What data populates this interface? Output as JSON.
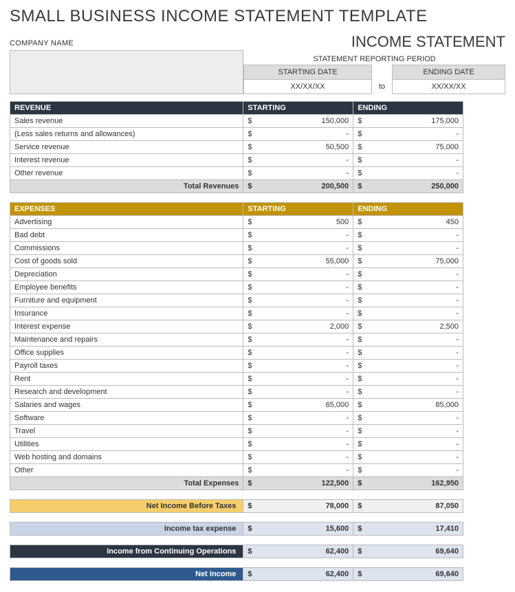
{
  "title": "SMALL BUSINESS INCOME STATEMENT TEMPLATE",
  "subtitle": "INCOME STATEMENT",
  "company": {
    "label": "COMPANY NAME"
  },
  "period": {
    "title": "STATEMENT REPORTING PERIOD",
    "start_label": "STARTING DATE",
    "end_label": "ENDING DATE",
    "start": "XX/XX/XX",
    "to": "to",
    "end": "XX/XX/XX"
  },
  "revenue": {
    "header": "REVENUE",
    "col_start": "STARTING",
    "col_end": "ENDING",
    "rows": [
      {
        "label": "Sales revenue",
        "start": "150,000",
        "end": "175,000"
      },
      {
        "label": "(Less sales returns and allowances)",
        "start": "-",
        "end": "-"
      },
      {
        "label": "Service revenue",
        "start": "50,500",
        "end": "75,000"
      },
      {
        "label": "Interest revenue",
        "start": "-",
        "end": "-"
      },
      {
        "label": "Other revenue",
        "start": "-",
        "end": "-"
      }
    ],
    "total_label": "Total Revenues",
    "total_start": "200,500",
    "total_end": "250,000"
  },
  "expenses": {
    "header": "EXPENSES",
    "col_start": "STARTING",
    "col_end": "ENDING",
    "rows": [
      {
        "label": "Advertising",
        "start": "500",
        "end": "450"
      },
      {
        "label": "Bad debt",
        "start": "-",
        "end": "-"
      },
      {
        "label": "Commissions",
        "start": "-",
        "end": "-"
      },
      {
        "label": "Cost of goods sold",
        "start": "55,000",
        "end": "75,000"
      },
      {
        "label": "Depreciation",
        "start": "-",
        "end": "-"
      },
      {
        "label": "Employee benefits",
        "start": "-",
        "end": "-"
      },
      {
        "label": "Furniture and equipment",
        "start": "-",
        "end": "-"
      },
      {
        "label": "Insurance",
        "start": "-",
        "end": "-"
      },
      {
        "label": "Interest expense",
        "start": "2,000",
        "end": "2,500"
      },
      {
        "label": "Maintenance and repairs",
        "start": "-",
        "end": "-"
      },
      {
        "label": "Office supplies",
        "start": "-",
        "end": "-"
      },
      {
        "label": "Payroll taxes",
        "start": "-",
        "end": "-"
      },
      {
        "label": "Rent",
        "start": "-",
        "end": "-"
      },
      {
        "label": "Research and development",
        "start": "-",
        "end": "-"
      },
      {
        "label": "Salaries and wages",
        "start": "65,000",
        "end": "85,000"
      },
      {
        "label": "Software",
        "start": "-",
        "end": "-"
      },
      {
        "label": "Travel",
        "start": "-",
        "end": "-"
      },
      {
        "label": "Utilities",
        "start": "-",
        "end": "-"
      },
      {
        "label": "Web hosting and domains",
        "start": "-",
        "end": "-"
      },
      {
        "label": "Other",
        "start": "-",
        "end": "-"
      }
    ],
    "total_label": "Total Expenses",
    "total_start": "122,500",
    "total_end": "162,950"
  },
  "summary": {
    "nibt": {
      "label": "Net Income Before Taxes",
      "start": "78,000",
      "end": "87,050"
    },
    "tax": {
      "label": "Income tax expense",
      "start": "15,600",
      "end": "17,410"
    },
    "ifco": {
      "label": "Income from Continuing Operations",
      "start": "62,400",
      "end": "69,640"
    },
    "net": {
      "label": "Net Income",
      "start": "62,400",
      "end": "69,640"
    }
  },
  "currency": "$"
}
